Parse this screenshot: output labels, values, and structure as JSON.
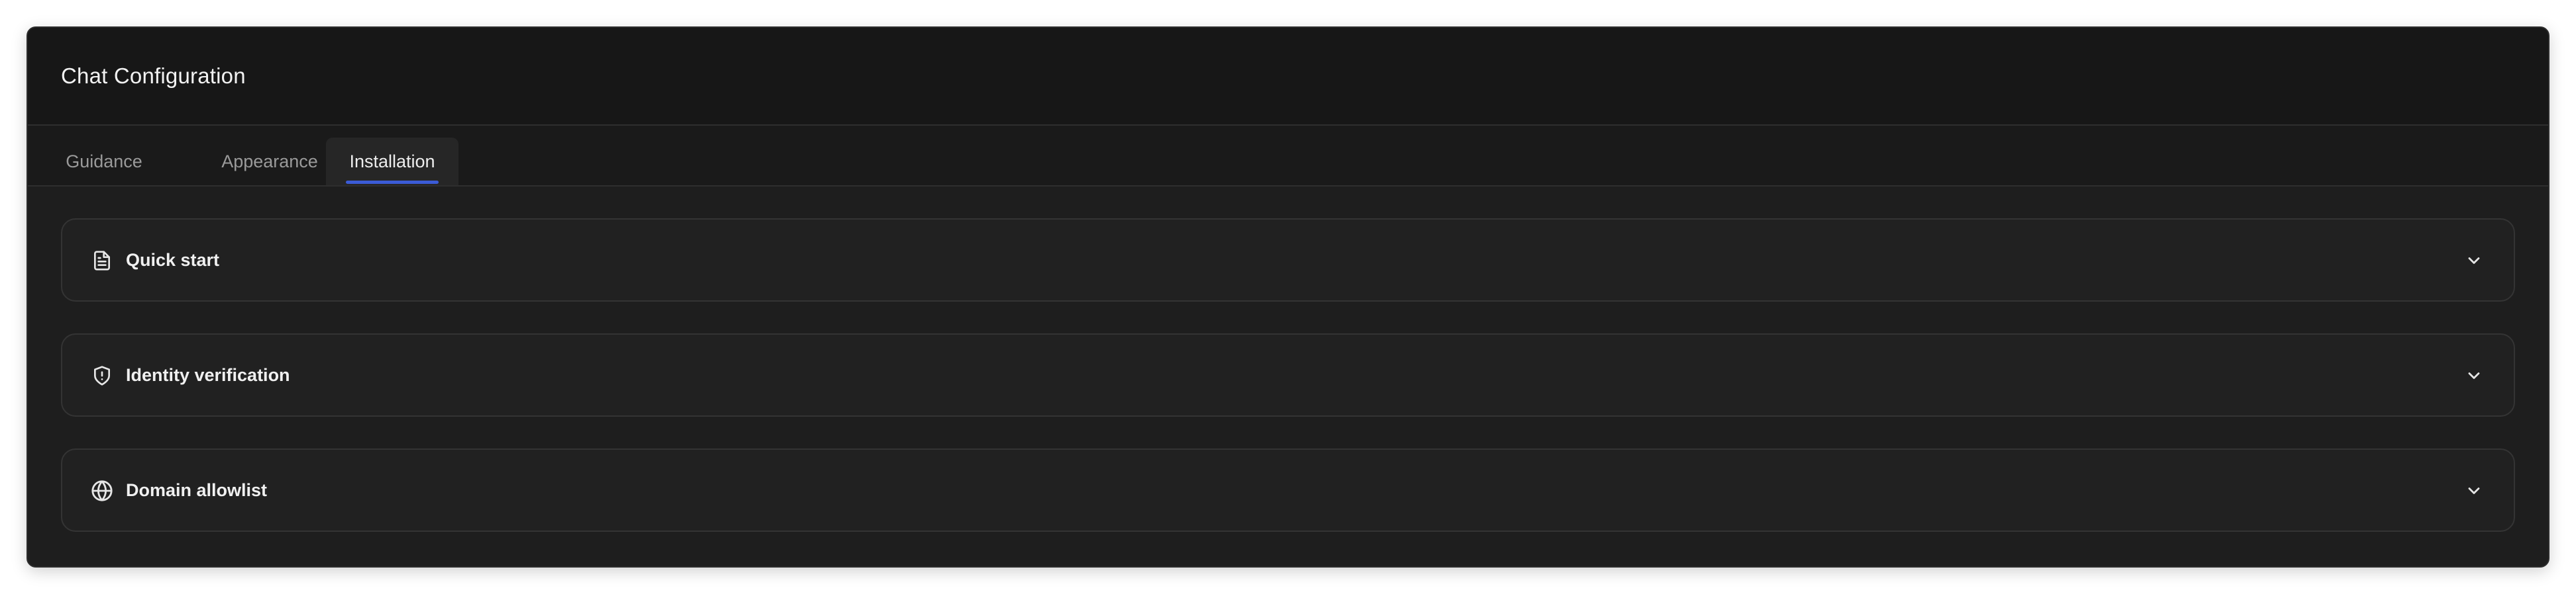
{
  "window": {
    "title": "Chat Configuration"
  },
  "tabs": [
    {
      "label": "Guidance",
      "active": false
    },
    {
      "label": "Appearance",
      "active": false
    },
    {
      "label": "Installation",
      "active": true
    }
  ],
  "sections": [
    {
      "label": "Quick start",
      "icon": "document-icon",
      "expanded": false
    },
    {
      "label": "Identity verification",
      "icon": "shield-icon",
      "expanded": false
    },
    {
      "label": "Domain allowlist",
      "icon": "globe-icon",
      "expanded": false
    }
  ],
  "colors": {
    "accent": "#3b5bd6",
    "card_background": "#1e1e1e",
    "header_background": "#171717",
    "text_primary": "#f0f0f0",
    "text_muted": "#9a9a9a"
  }
}
